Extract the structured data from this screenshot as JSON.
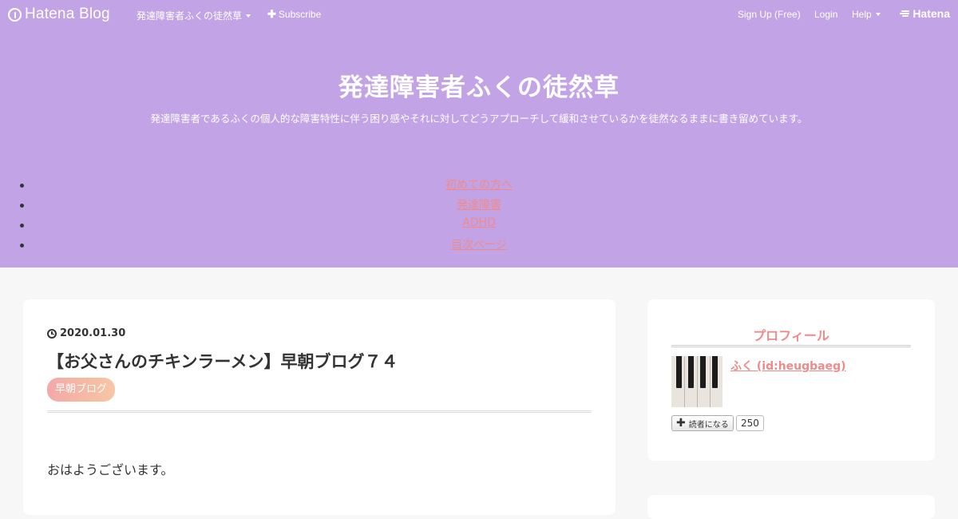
{
  "topbar": {
    "logo_text": "Hatena Blog",
    "blog_menu_label": "発達障害者ふくの徒然草",
    "subscribe_label": "Subscribe",
    "signup_label": "Sign Up (Free)",
    "login_label": "Login",
    "help_label": "Help",
    "brand_label": "Hatena"
  },
  "header": {
    "title": "発達障害者ふくの徒然草",
    "description": "発達障害者であるふくの個人的な障害特性に伴う困り感やそれに対してどうアプローチして緩和させているかを徒然なるままに書き留めています。",
    "nav_items": [
      {
        "label": "初めての方へ"
      },
      {
        "label": "発達障害"
      },
      {
        "label": "ADHD"
      },
      {
        "label": "目次ページ"
      }
    ]
  },
  "article": {
    "date": "2020.01.30",
    "title": "【お父さんのチキンラーメン】早朝ブログ７４",
    "category": "早朝ブログ",
    "body_first_line": "おはようございます。"
  },
  "sidebar": {
    "profile_title": "プロフィール",
    "profile_name": "ふく (id:heugbaeg)",
    "reader_button_label": "読者になる",
    "reader_count": "250"
  },
  "colors": {
    "header_bg": "#c2a4e6",
    "accent_pink": "#f08a8a",
    "page_bg": "#f7f7f7"
  }
}
